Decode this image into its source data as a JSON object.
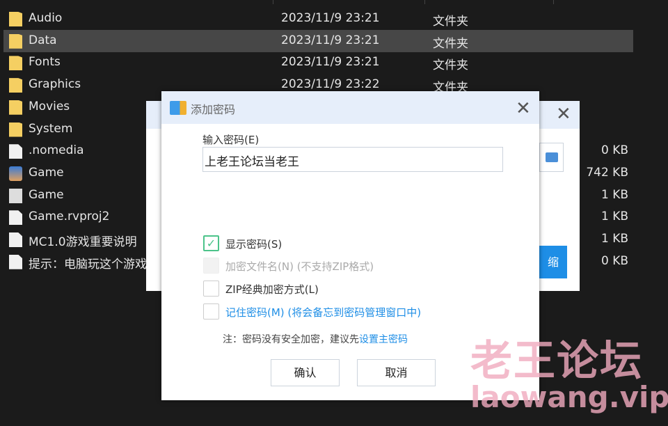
{
  "files": [
    {
      "name": "Audio",
      "date": "2023/11/9 23:21",
      "type": "文件夹",
      "size": "",
      "icon": "folder-icon"
    },
    {
      "name": "Data",
      "date": "2023/11/9 23:21",
      "type": "文件夹",
      "size": "",
      "icon": "folder-icon",
      "selected": true
    },
    {
      "name": "Fonts",
      "date": "2023/11/9 23:21",
      "type": "文件夹",
      "size": "",
      "icon": "folder-icon"
    },
    {
      "name": "Graphics",
      "date": "2023/11/9 23:22",
      "type": "文件夹",
      "size": "",
      "icon": "folder-icon"
    },
    {
      "name": "Movies",
      "date": "",
      "type": "",
      "size": "",
      "icon": "folder-icon"
    },
    {
      "name": "System",
      "date": "",
      "type": "",
      "size": "",
      "icon": "folder-icon"
    },
    {
      "name": ".nomedia",
      "date": "",
      "type": "",
      "size": "0 KB",
      "icon": "file-icon"
    },
    {
      "name": "Game",
      "date": "",
      "type": "",
      "size": "742 KB",
      "icon": "game-icon"
    },
    {
      "name": "Game",
      "date": "",
      "type": "",
      "size": "1 KB",
      "icon": "config-file-icon"
    },
    {
      "name": "Game.rvproj2",
      "date": "",
      "type": "",
      "size": "1 KB",
      "icon": "file-icon"
    },
    {
      "name": "MC1.0游戏重要说明",
      "date": "",
      "type": "",
      "size": "1 KB",
      "icon": "text-file-icon"
    },
    {
      "name": "提示：电脑玩这个游戏",
      "date": "",
      "type": "",
      "size": "0 KB",
      "icon": "file-icon"
    }
  ],
  "back_dialog": {
    "button_partial": "缩"
  },
  "dialog": {
    "title": "添加密码",
    "password_label": "输入密码(E)",
    "password_value": "上老王论坛当老王",
    "options": [
      {
        "label": "显示密码(S)",
        "checked": true,
        "disabled": false
      },
      {
        "label": "加密文件名(N) (不支持ZIP格式)",
        "checked": false,
        "disabled": true
      },
      {
        "label": "ZIP经典加密方式(L)",
        "checked": false,
        "disabled": false
      },
      {
        "label": "记住密码(M) (将会备忘到密码管理窗口中)",
        "checked": false,
        "disabled": false,
        "link": true
      }
    ],
    "note": "注：密码没有安全加密，建议先",
    "note_link": "设置主密码",
    "ok": "确认",
    "cancel": "取消"
  },
  "watermark": {
    "line1": "老王论坛",
    "line2": "laowang.vip"
  },
  "colors": {
    "accent": "#1e8ee6",
    "check": "#4cc38a",
    "selection": "#474747"
  }
}
